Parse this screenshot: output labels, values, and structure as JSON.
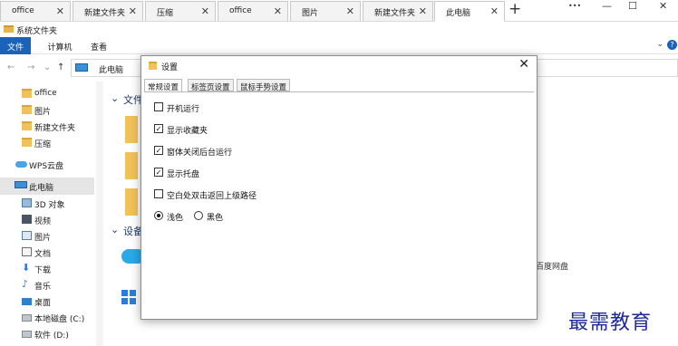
{
  "tabs": [
    {
      "label": "office",
      "active": false
    },
    {
      "label": "新建文件夹",
      "active": false
    },
    {
      "label": "压缩",
      "active": false
    },
    {
      "label": "office",
      "active": false
    },
    {
      "label": "图片",
      "active": false
    },
    {
      "label": "新建文件夹",
      "active": false
    },
    {
      "label": "此电脑",
      "active": true
    }
  ],
  "tab_close_glyph": "✕",
  "tab_add_glyph": "+",
  "window": {
    "more_glyph": "•••",
    "minimize_glyph": "—",
    "maximize_glyph": "☐",
    "close_glyph": "✕"
  },
  "system_folder": "系统文件夹",
  "ribbon": {
    "file": "文件",
    "computer": "计算机",
    "view": "查看",
    "chevron": "⌄",
    "help": "?"
  },
  "nav": {
    "back": "←",
    "forward": "→",
    "recent": "⌄",
    "up": "↑"
  },
  "address": {
    "path": "此电脑"
  },
  "sidebar": {
    "items": [
      {
        "label": "office",
        "icon": "folder-icon"
      },
      {
        "label": "图片",
        "icon": "folder-icon"
      },
      {
        "label": "新建文件夹",
        "icon": "folder-icon"
      },
      {
        "label": "压缩",
        "icon": "folder-icon"
      },
      {
        "label": "WPS云盘",
        "icon": "cloud-icon"
      },
      {
        "label": "此电脑",
        "icon": "computer-icon",
        "selected": true
      },
      {
        "label": "3D 对象",
        "icon": "cube-icon"
      },
      {
        "label": "视频",
        "icon": "video-icon"
      },
      {
        "label": "图片",
        "icon": "picture-icon"
      },
      {
        "label": "文档",
        "icon": "document-icon"
      },
      {
        "label": "下载",
        "icon": "download-icon"
      },
      {
        "label": "音乐",
        "icon": "music-icon"
      },
      {
        "label": "桌面",
        "icon": "desktop-icon"
      },
      {
        "label": "本地磁盘 (C:)",
        "icon": "drive-icon"
      },
      {
        "label": "软件 (D:)",
        "icon": "drive-icon"
      }
    ],
    "scroll_up_glyph": "▲"
  },
  "main": {
    "section_folders": "文件",
    "section_devices": "设备",
    "collapse_glyph": "⌄",
    "cloud_disk_text": "百度网盘"
  },
  "dialog": {
    "title": "设置",
    "close_glyph": "✕",
    "tabs": [
      "常规设置",
      "标签页设置",
      "鼠标手势设置"
    ],
    "options": [
      {
        "label": "开机运行",
        "checked": false
      },
      {
        "label": "显示收藏夹",
        "checked": true
      },
      {
        "label": "窗体关闭后台运行",
        "checked": true
      },
      {
        "label": "显示托盘",
        "checked": true
      },
      {
        "label": "空白处双击返回上级路径",
        "checked": false
      }
    ],
    "theme": {
      "light": "浅色",
      "dark": "黑色",
      "selected": "light"
    },
    "check_glyph": "✓"
  },
  "watermark": "最需教育",
  "colors": {
    "accent": "#1a63b8",
    "folder": "#f0c25a",
    "watermark": "#1f2a9a"
  }
}
